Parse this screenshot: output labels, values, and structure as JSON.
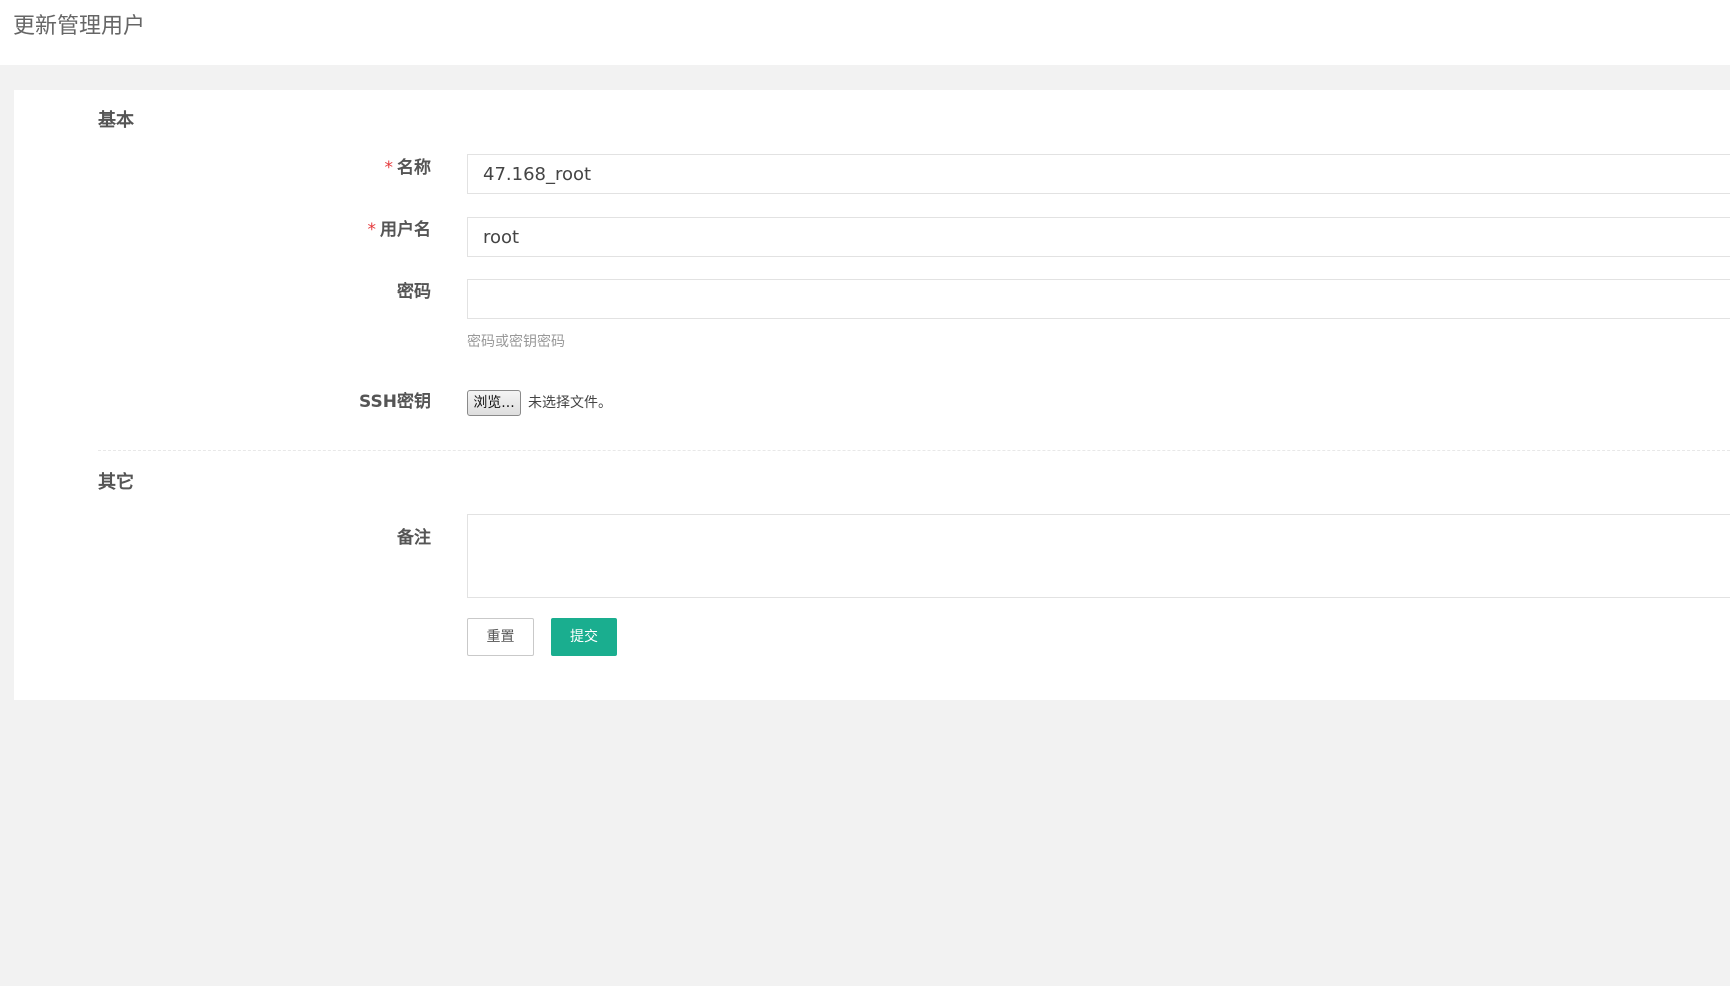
{
  "header": {
    "title": "更新管理用户"
  },
  "sections": {
    "basic": {
      "title": "基本"
    },
    "other": {
      "title": "其它"
    }
  },
  "form": {
    "name": {
      "required_mark": "*",
      "label": "名称",
      "value": "47.168_root"
    },
    "username": {
      "required_mark": "*",
      "label": "用户名",
      "value": "root"
    },
    "password": {
      "label": "密码",
      "value": "",
      "help": "密码或密钥密码"
    },
    "ssh_key": {
      "label": "SSH密钥",
      "browse_label": "浏览...",
      "file_status": "未选择文件。"
    },
    "remark": {
      "label": "备注",
      "value": ""
    }
  },
  "actions": {
    "reset_label": "重置",
    "submit_label": "提交"
  },
  "colors": {
    "primary": "#1aae8f",
    "required": "#e4393c",
    "background": "#f2f2f2"
  }
}
